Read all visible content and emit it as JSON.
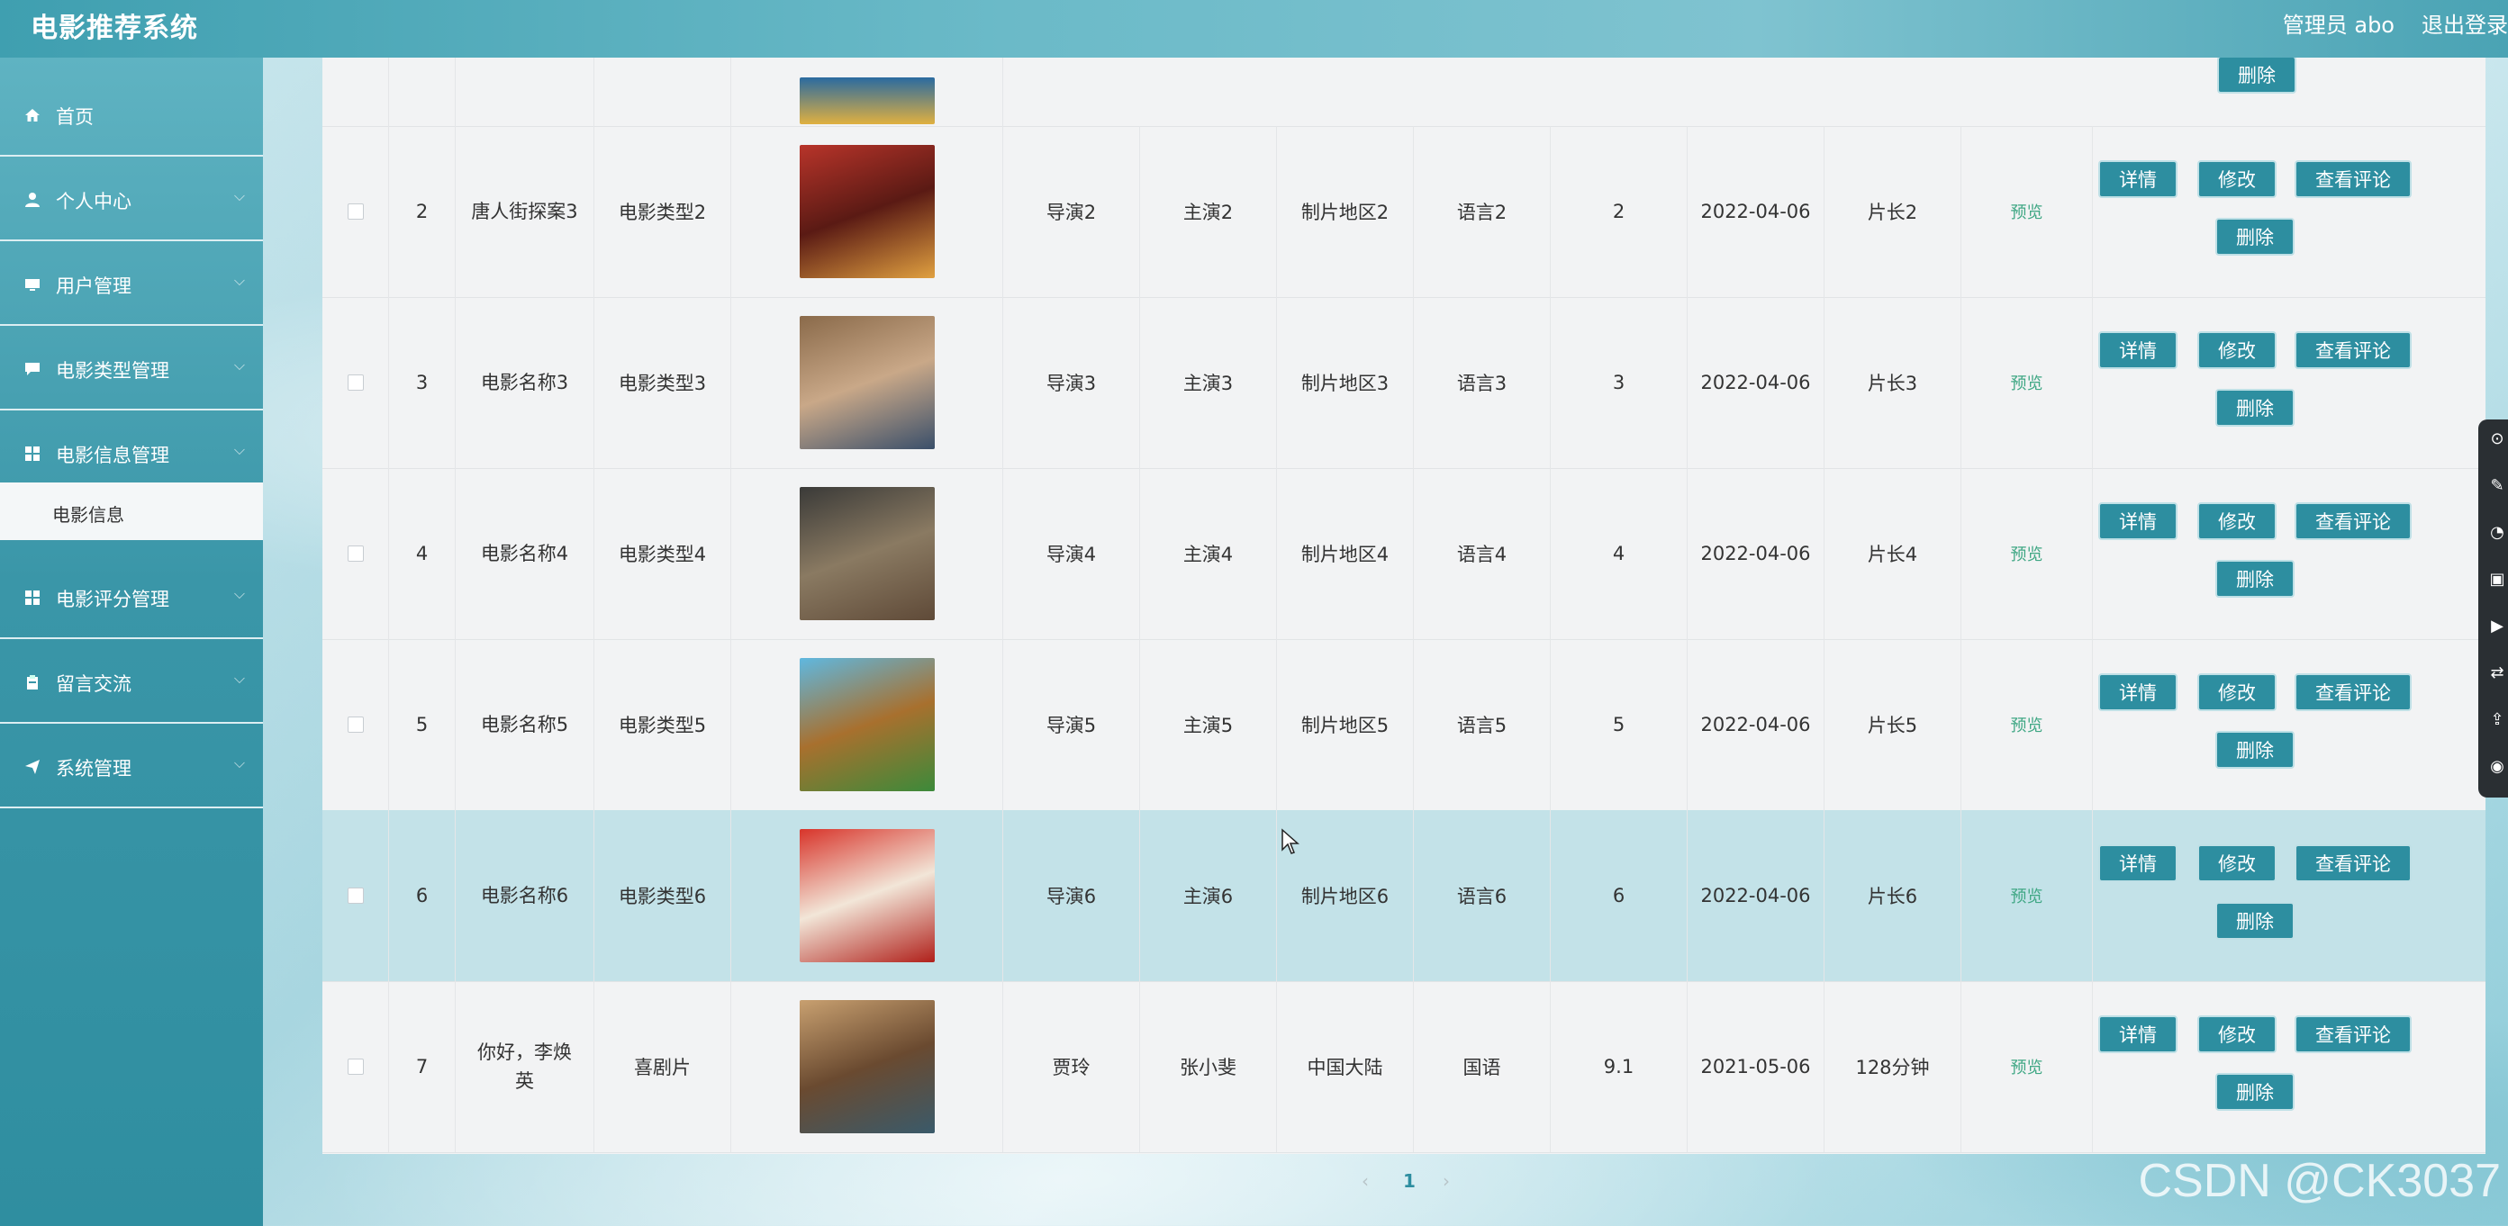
{
  "header": {
    "title": "电影推荐系统",
    "admin": "管理员 abo",
    "logout": "退出登录"
  },
  "sidebar": {
    "items": [
      {
        "label": "首页",
        "icon": "home-icon"
      },
      {
        "label": "个人中心",
        "icon": "user-icon"
      },
      {
        "label": "用户管理",
        "icon": "monitor-icon"
      },
      {
        "label": "电影类型管理",
        "icon": "chat-icon"
      },
      {
        "label": "电影信息管理",
        "icon": "grid-icon"
      },
      {
        "label": "电影评分管理",
        "icon": "grid-icon"
      },
      {
        "label": "留言交流",
        "icon": "clipboard-icon"
      },
      {
        "label": "系统管理",
        "icon": "send-icon"
      }
    ],
    "active_sub": "电影信息"
  },
  "table": {
    "top_row_action": "删除",
    "rows": [
      {
        "index": "2",
        "name": "唐人街探案3",
        "type": "电影类型2",
        "director": "导演2",
        "actor": "主演2",
        "region": "制片地区2",
        "language": "语言2",
        "score": "2",
        "date": "2022-04-06",
        "duration": "片长2",
        "preview": "预览",
        "poster_colors": [
          "#b8342a",
          "#5a1a14",
          "#e0a040"
        ]
      },
      {
        "index": "3",
        "name": "电影名称3",
        "type": "电影类型3",
        "director": "导演3",
        "actor": "主演3",
        "region": "制片地区3",
        "language": "语言3",
        "score": "3",
        "date": "2022-04-06",
        "duration": "片长3",
        "preview": "预览",
        "poster_colors": [
          "#8a6a4a",
          "#c9a888",
          "#3a4f6a"
        ]
      },
      {
        "index": "4",
        "name": "电影名称4",
        "type": "电影类型4",
        "director": "导演4",
        "actor": "主演4",
        "region": "制片地区4",
        "language": "语言4",
        "score": "4",
        "date": "2022-04-06",
        "duration": "片长4",
        "preview": "预览",
        "poster_colors": [
          "#3a3a38",
          "#8a7a62",
          "#5f4a38"
        ]
      },
      {
        "index": "5",
        "name": "电影名称5",
        "type": "电影类型5",
        "director": "导演5",
        "actor": "主演5",
        "region": "制片地区5",
        "language": "语言5",
        "score": "5",
        "date": "2022-04-06",
        "duration": "片长5",
        "preview": "预览",
        "poster_colors": [
          "#5fb8e0",
          "#a8702e",
          "#3c8a3a"
        ]
      },
      {
        "index": "6",
        "name": "电影名称6",
        "type": "电影类型6",
        "director": "导演6",
        "actor": "主演6",
        "region": "制片地区6",
        "language": "语言6",
        "score": "6",
        "date": "2022-04-06",
        "duration": "片长6",
        "preview": "预览",
        "poster_colors": [
          "#d8342a",
          "#f2e6d8",
          "#b0201a"
        ]
      },
      {
        "index": "7",
        "name": "你好，李焕英",
        "type": "喜剧片",
        "director": "贾玲",
        "actor": "张小斐",
        "region": "中国大陆",
        "language": "国语",
        "score": "9.1",
        "date": "2021-05-06",
        "duration": "128分钟",
        "preview": "预览",
        "poster_colors": [
          "#c8a070",
          "#6a4a30",
          "#3a5a6a"
        ]
      }
    ],
    "actions": {
      "detail": "详情",
      "edit": "修改",
      "comments": "查看评论",
      "delete": "删除"
    }
  },
  "pagination": {
    "prev": "‹",
    "page": "1",
    "next": "›"
  },
  "watermark": "CSDN @CK3037",
  "colors": {
    "accent": "#2d8ea0",
    "preview": "#3fa784",
    "highlight_row": "#c3e2e8"
  }
}
